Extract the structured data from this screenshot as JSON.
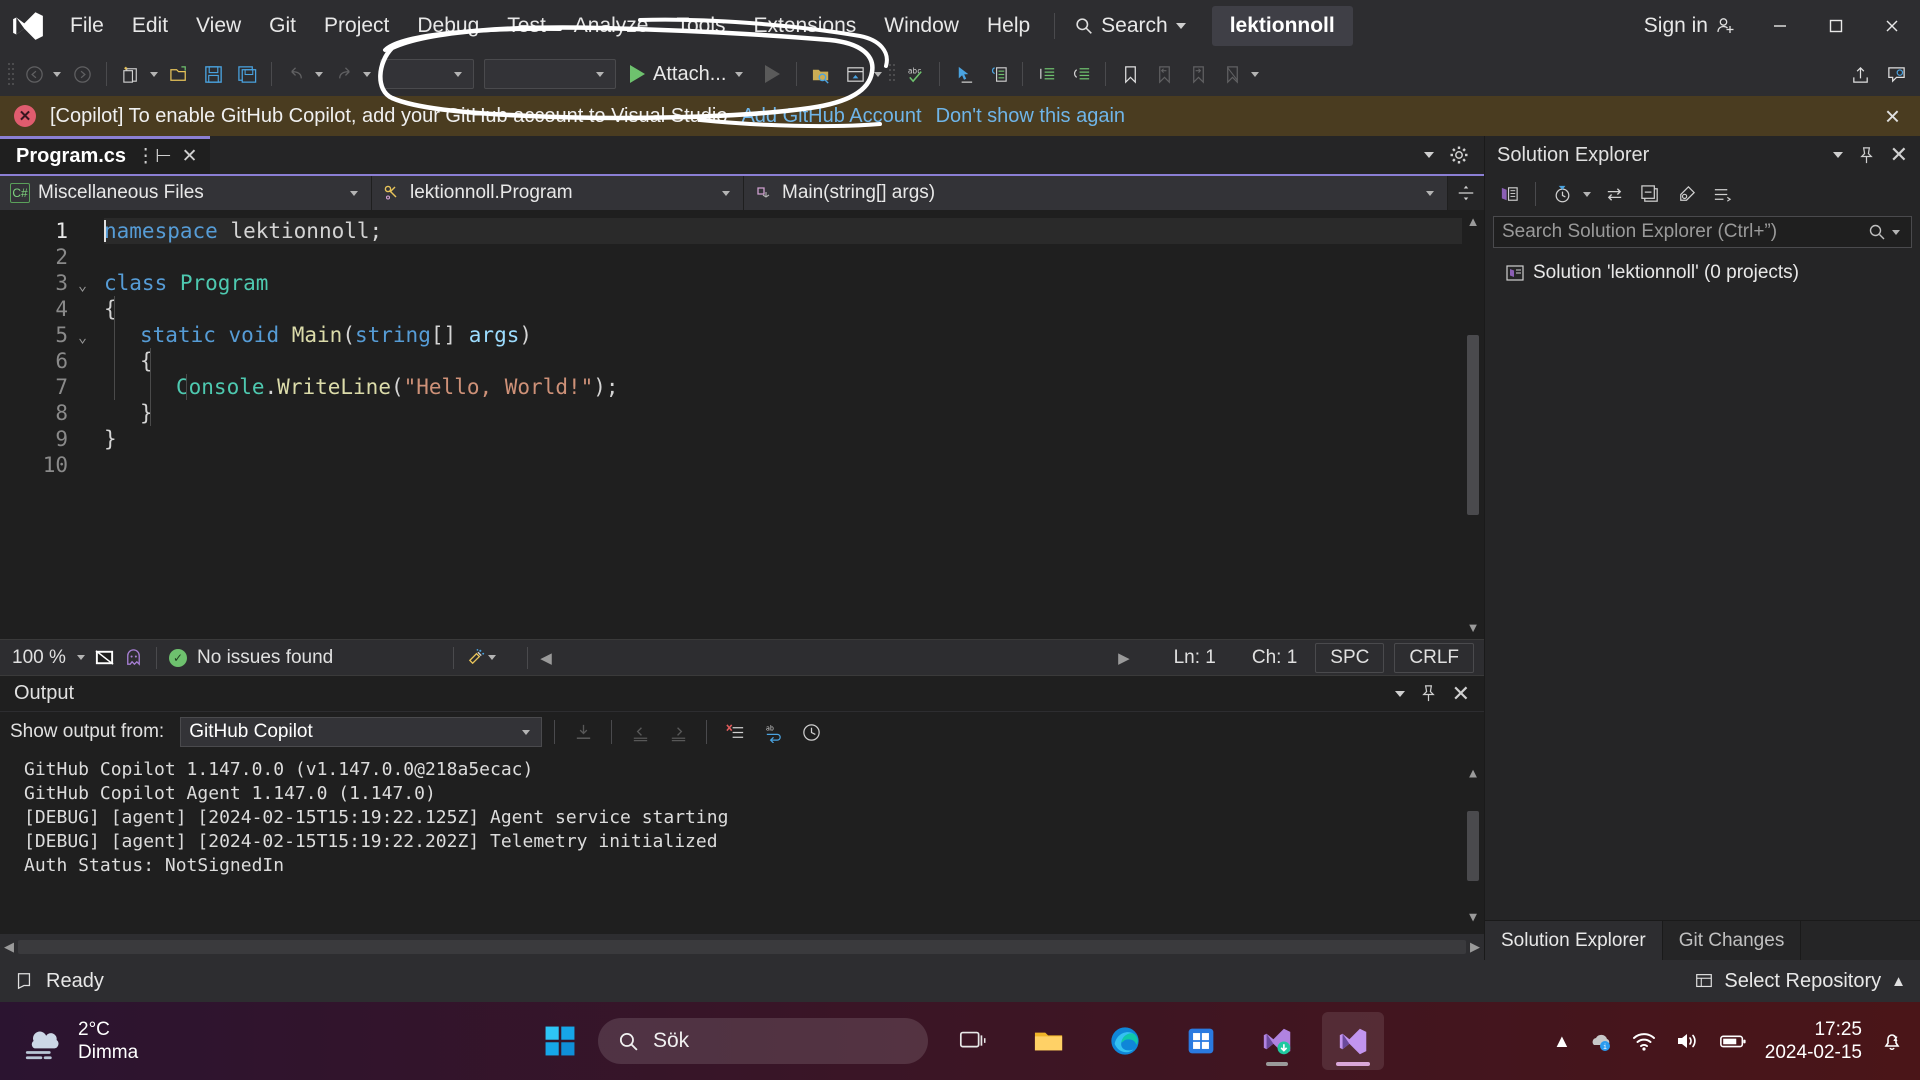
{
  "titlebar": {
    "menus": [
      "File",
      "Edit",
      "View",
      "Git",
      "Project",
      "Debug",
      "Test",
      "Analyze",
      "Tools",
      "Extensions",
      "Window",
      "Help"
    ],
    "search_label": "Search",
    "project_badge": "lektionnoll",
    "sign_in": "Sign in"
  },
  "toolbar": {
    "attach_label": "Attach...",
    "combo1_value": "",
    "combo2_value": ""
  },
  "notification": {
    "message": "[Copilot] To enable GitHub Copilot, add your GitHub account to Visual Studio",
    "link_primary": "Add GitHub Account",
    "link_secondary": "Don't show this again",
    "close_label": "×",
    "background": "#4a3c20"
  },
  "editor": {
    "tab_name": "Program.cs",
    "nav": {
      "project": "Miscellaneous Files",
      "type": "lektionnoll.Program",
      "member": "Main(string[] args)"
    },
    "lines": [
      {
        "num": "1",
        "indent": 0,
        "highlight": true,
        "caret": true,
        "tokens": [
          {
            "t": "namespace",
            "c": "k-blue"
          },
          {
            "t": " lektionnoll;",
            "c": "k-ns"
          }
        ]
      },
      {
        "num": "2",
        "indent": 0,
        "tokens": []
      },
      {
        "num": "3",
        "indent": 0,
        "fold": "v",
        "tokens": [
          {
            "t": "class",
            "c": "k-blue"
          },
          {
            "t": " ",
            "c": "k-ns"
          },
          {
            "t": "Program",
            "c": "k-teal"
          }
        ]
      },
      {
        "num": "4",
        "indent": 0,
        "tokens": [
          {
            "t": "{",
            "c": "k-ns"
          }
        ]
      },
      {
        "num": "5",
        "indent": 1,
        "fold": "v",
        "tokens": [
          {
            "t": "static",
            "c": "k-blue"
          },
          {
            "t": " ",
            "c": "k-ns"
          },
          {
            "t": "void",
            "c": "k-blue"
          },
          {
            "t": " ",
            "c": "k-ns"
          },
          {
            "t": "Main",
            "c": "k-yellow"
          },
          {
            "t": "(",
            "c": "k-ns"
          },
          {
            "t": "string",
            "c": "k-blue"
          },
          {
            "t": "[] ",
            "c": "k-ns"
          },
          {
            "t": "args",
            "c": "k-light"
          },
          {
            "t": ")",
            "c": "k-ns"
          }
        ]
      },
      {
        "num": "6",
        "indent": 1,
        "tokens": [
          {
            "t": "{",
            "c": "k-ns"
          }
        ]
      },
      {
        "num": "7",
        "indent": 2,
        "tokens": [
          {
            "t": "Console",
            "c": "k-teal"
          },
          {
            "t": ".",
            "c": "k-ns"
          },
          {
            "t": "WriteLine",
            "c": "k-yellow"
          },
          {
            "t": "(",
            "c": "k-ns"
          },
          {
            "t": "\"Hello, World!\"",
            "c": "k-orange"
          },
          {
            "t": ");",
            "c": "k-ns"
          }
        ]
      },
      {
        "num": "8",
        "indent": 1,
        "tokens": [
          {
            "t": "}",
            "c": "k-ns"
          }
        ]
      },
      {
        "num": "9",
        "indent": 0,
        "tokens": [
          {
            "t": "}",
            "c": "k-ns"
          }
        ]
      },
      {
        "num": "10",
        "indent": 0,
        "tokens": []
      }
    ]
  },
  "editor_status": {
    "zoom": "100 %",
    "issues": "No issues found",
    "line": "Ln: 1",
    "column": "Ch: 1",
    "spaces": "SPC",
    "eol": "CRLF"
  },
  "output": {
    "title": "Output",
    "show_from_label": "Show output from:",
    "source": "GitHub Copilot",
    "lines": [
      "GitHub Copilot 1.147.0.0 (v1.147.0.0@218a5ecac)",
      "GitHub Copilot Agent 1.147.0 (1.147.0)",
      "[DEBUG] [agent] [2024-02-15T15:19:22.125Z] Agent service starting",
      "[DEBUG] [agent] [2024-02-15T15:19:22.202Z] Telemetry initialized",
      "Auth Status: NotSignedIn"
    ]
  },
  "solution_explorer": {
    "title": "Solution Explorer",
    "search_placeholder": "Search Solution Explorer (Ctrl+”)",
    "root_node": "Solution 'lektionnoll' (0 projects)",
    "tabs": [
      "Solution Explorer",
      "Git Changes"
    ]
  },
  "vs_status": {
    "ready": "Ready",
    "repository": "Select Repository"
  },
  "taskbar": {
    "weather_temp": "2°C",
    "weather_desc": "Dimma",
    "search_placeholder": "Sök",
    "time": "17:25",
    "date": "2024-02-15"
  }
}
